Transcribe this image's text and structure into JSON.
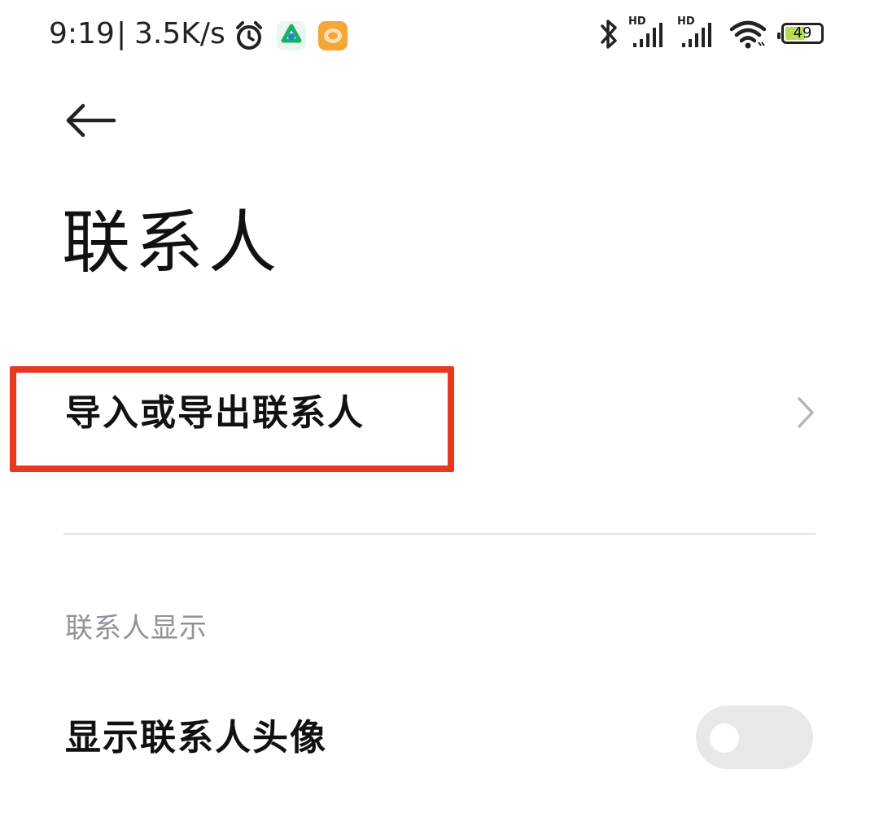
{
  "status_bar": {
    "time": "9:19",
    "separator": "|",
    "net_speed": "3.5K/s",
    "battery": "49",
    "signal_label_1": "HD",
    "signal_label_2": "HD",
    "icons": [
      "alarm-icon",
      "green-app-icon",
      "orange-app-icon",
      "bluetooth-icon",
      "signal-hd-icon",
      "signal-hd-icon",
      "wifi-icon",
      "battery-icon"
    ]
  },
  "header": {
    "back_icon": "back-arrow-icon",
    "title": "联系人"
  },
  "items": {
    "import_export": {
      "label": "导入或导出联系人",
      "chevron_icon": "chevron-right-icon"
    },
    "display_section": {
      "title": "联系人显示"
    },
    "show_avatar": {
      "label": "显示联系人头像",
      "toggle_on": false
    }
  },
  "colors": {
    "highlight": "#e8391f",
    "section_header": "#8f939a",
    "toggle_off": "#e8e8e8"
  }
}
